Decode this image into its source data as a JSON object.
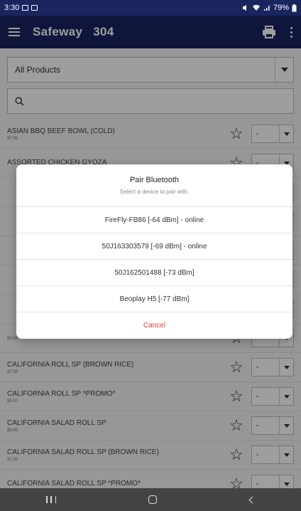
{
  "status_bar": {
    "time": "3:30",
    "battery": "79%"
  },
  "app_bar": {
    "title": "Safeway",
    "store_number": "304"
  },
  "filter": {
    "selected": "All Products"
  },
  "products": [
    {
      "name": "ASIAN BBQ BEEF BOWL (COLD)",
      "price": "$7.99",
      "qty": "-"
    },
    {
      "name": "ASSORTED CHICKEN GYOZA",
      "price": "",
      "qty": "-"
    },
    {
      "name": "",
      "price": "",
      "qty": "-"
    },
    {
      "name": "",
      "price": "",
      "qty": "-"
    },
    {
      "name": "",
      "price": "",
      "qty": "-"
    },
    {
      "name": "",
      "price": "",
      "qty": "-"
    },
    {
      "name": "",
      "price": "",
      "qty": "-"
    },
    {
      "name": "",
      "price": "$6.99",
      "qty": "-"
    },
    {
      "name": "CALIFORNIA ROLL SP (BROWN RICE)",
      "price": "$7.99",
      "qty": "-"
    },
    {
      "name": "CALIFORNIA ROLL SP *PROMO*",
      "price": "$5.00",
      "qty": "-"
    },
    {
      "name": "CALIFORNIA SALAD ROLL SP",
      "price": "$6.99",
      "qty": "-"
    },
    {
      "name": "CALIFORNIA SALAD ROLL SP (BROWN RICE)",
      "price": "$7.99",
      "qty": "-"
    },
    {
      "name": "CALIFORNIA SALAD ROLL SP *PROMO*",
      "price": "",
      "qty": "-"
    }
  ],
  "dialog": {
    "title": "Pair Bluetooth",
    "subtitle": "Select a device to pair with.",
    "devices": [
      "FireFly-FB86 [-64 dBm] - online",
      "50J163303579 [-69 dBm] - online",
      "50J162501488 [-73 dBm]",
      "Beoplay H5 [-77 dBm]"
    ],
    "cancel_label": "Cancel"
  },
  "colors": {
    "app_bar": "#1a2560",
    "cancel": "#e53935"
  },
  "icons": [
    "menu-icon",
    "printer-icon",
    "more-vert-icon",
    "search-icon",
    "star-outline-icon",
    "dropdown-arrow-icon"
  ]
}
